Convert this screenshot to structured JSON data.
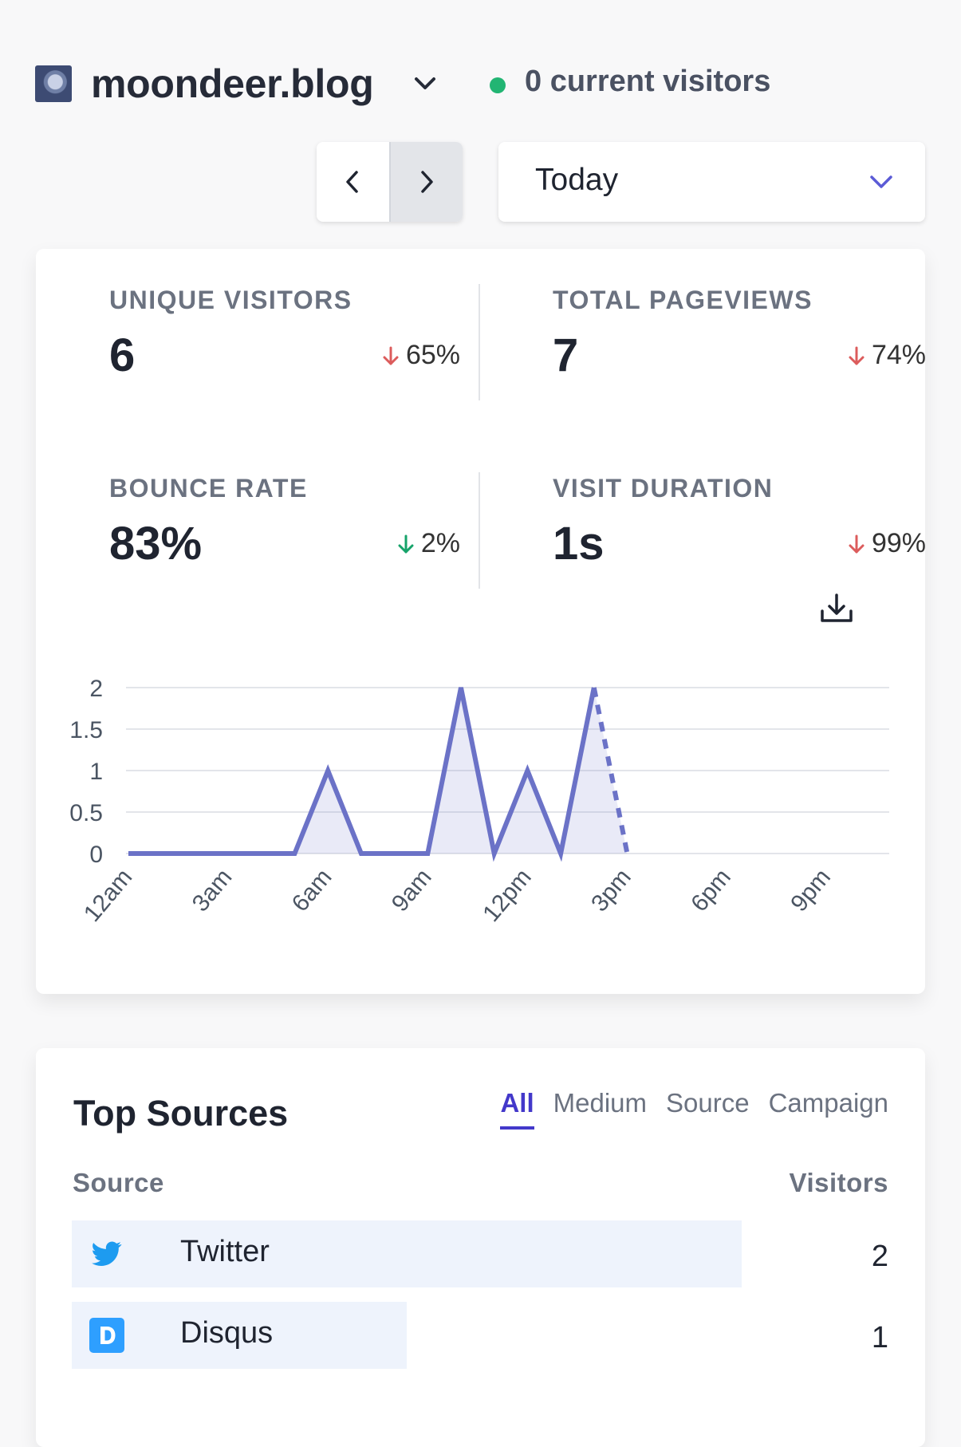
{
  "header": {
    "site_name": "moondeer.blog",
    "visitors_text": "0 current visitors",
    "live_dot_color": "#22b573"
  },
  "controls": {
    "prev_icon": "chevron-left-icon",
    "next_icon": "chevron-right-icon",
    "period_label": "Today"
  },
  "stats": [
    {
      "label": "UNIQUE VISITORS",
      "value": "6",
      "change": "65%",
      "direction": "down",
      "color": "#dc5c5c"
    },
    {
      "label": "TOTAL PAGEVIEWS",
      "value": "7",
      "change": "74%",
      "direction": "down",
      "color": "#dc5c5c"
    },
    {
      "label": "BOUNCE RATE",
      "value": "83%",
      "change": "2%",
      "direction": "down",
      "color": "#16a36a"
    },
    {
      "label": "VISIT DURATION",
      "value": "1s",
      "change": "99%",
      "direction": "down",
      "color": "#dc5c5c"
    }
  ],
  "chart_data": {
    "type": "line",
    "x": [
      "12am",
      "1am",
      "2am",
      "3am",
      "4am",
      "5am",
      "6am",
      "7am",
      "8am",
      "9am",
      "10am",
      "11am",
      "12pm",
      "1pm",
      "2pm",
      "3pm"
    ],
    "series": [
      {
        "values": [
          0,
          0,
          0,
          0,
          0,
          0,
          1,
          0,
          0,
          0,
          2,
          0,
          1,
          0,
          2,
          0
        ]
      }
    ],
    "solid_until_index": 14,
    "ylim": [
      0,
      2
    ],
    "yticks": [
      "0",
      "0.5",
      "1",
      "1.5",
      "2"
    ],
    "xtick_labels": [
      "12am",
      "3am",
      "6am",
      "9am",
      "12pm",
      "3pm",
      "6pm",
      "9pm"
    ],
    "grid": true,
    "line_color": "#6b72c7"
  },
  "sources": {
    "title": "Top Sources",
    "tabs": [
      "All",
      "Medium",
      "Source",
      "Campaign"
    ],
    "active_tab": "All",
    "col_source": "Source",
    "col_visitors": "Visitors",
    "rows": [
      {
        "label": "Twitter",
        "value": "2",
        "icon": "twitter-icon",
        "share": 1.0
      },
      {
        "label": "Disqus",
        "value": "1",
        "icon": "disqus-icon",
        "share": 0.5
      }
    ]
  }
}
